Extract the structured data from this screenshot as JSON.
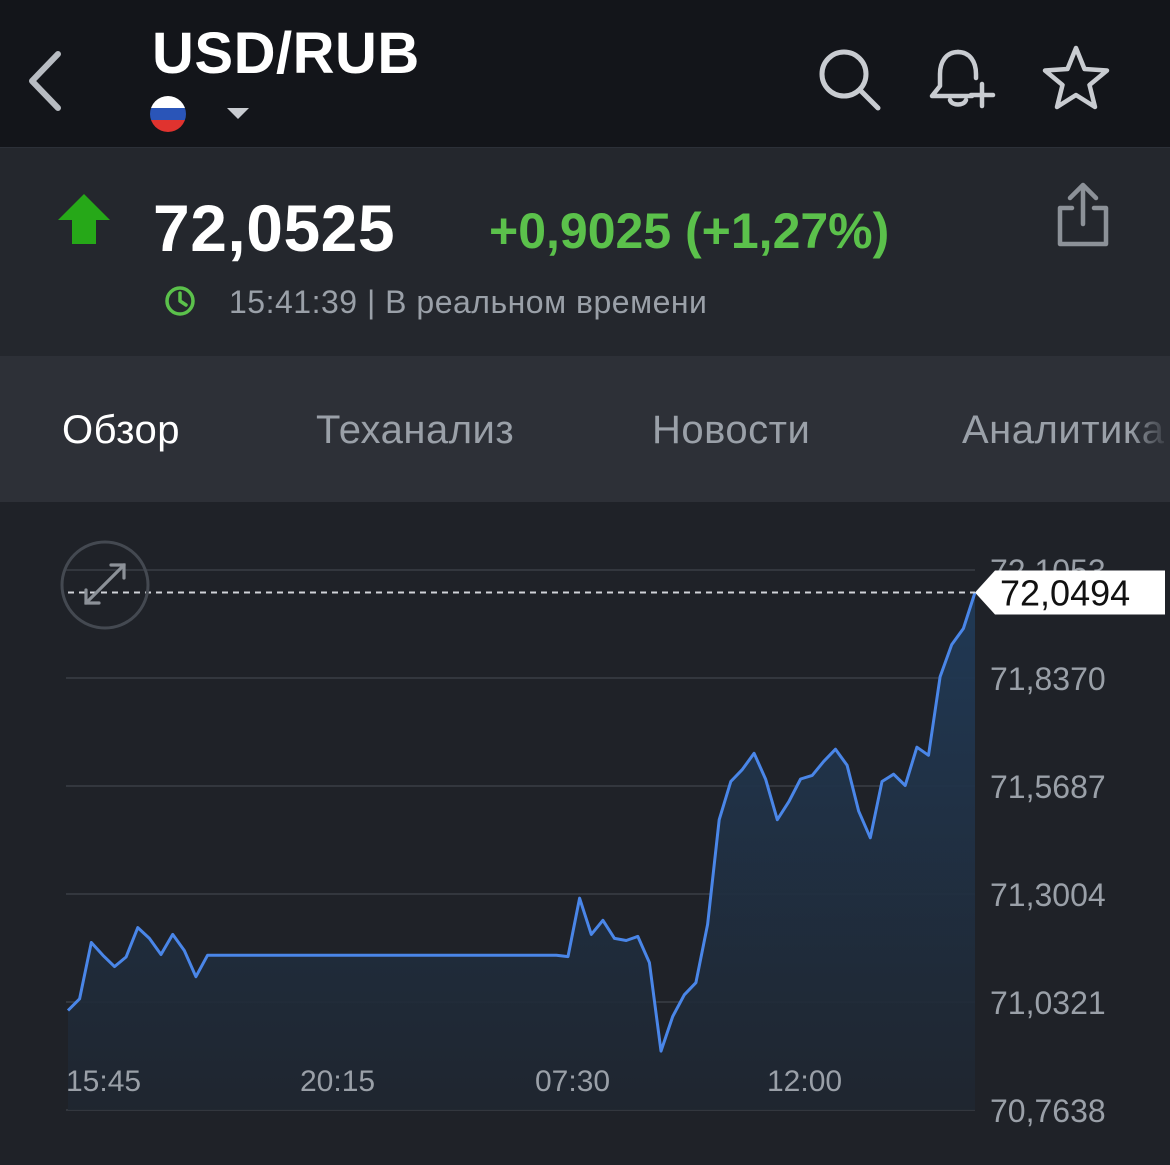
{
  "header": {
    "title": "USD/RUB",
    "icons": [
      "back-icon",
      "russia-flag-icon",
      "chevron-down-icon",
      "search-icon",
      "bell-plus-icon",
      "star-icon"
    ]
  },
  "quote": {
    "price": "72,0525",
    "change": "+0,9025 (+1,27%)",
    "time_text": "15:41:39 | В реальном времени",
    "direction": "up",
    "up_color": "#5bc14b"
  },
  "tabs": [
    {
      "label": "Обзор",
      "active": true
    },
    {
      "label": "Теханализ",
      "active": false
    },
    {
      "label": "Новости",
      "active": false
    },
    {
      "label": "Аналитика",
      "active": false
    }
  ],
  "chart_data": {
    "type": "area",
    "line_color": "#4a86e8",
    "x_tick_labels": [
      "15:45",
      "20:15",
      "07:30",
      "12:00"
    ],
    "y_tick_labels": [
      "72,1053",
      "71,8370",
      "71,5687",
      "71,3004",
      "71,0321",
      "70,7638"
    ],
    "ylim": [
      70.7638,
      72.1053
    ],
    "current_value": 72.0494,
    "current_label": "72,0494",
    "grid": true,
    "series": [
      {
        "values": [
          71.011,
          71.04,
          71.18,
          71.148,
          71.12,
          71.144,
          71.217,
          71.19,
          71.15,
          71.2,
          71.16,
          71.095,
          71.148,
          71.148,
          71.148,
          71.148,
          71.148,
          71.148,
          71.148,
          71.148,
          71.148,
          71.148,
          71.148,
          71.148,
          71.148,
          71.148,
          71.148,
          71.148,
          71.148,
          71.148,
          71.148,
          71.148,
          71.148,
          71.148,
          71.148,
          71.148,
          71.148,
          71.148,
          71.148,
          71.148,
          71.148,
          71.148,
          71.148,
          71.145,
          71.29,
          71.2,
          71.235,
          71.19,
          71.185,
          71.195,
          71.13,
          70.91,
          70.996,
          71.05,
          71.08,
          71.225,
          71.485,
          71.58,
          71.61,
          71.65,
          71.585,
          71.485,
          71.53,
          71.586,
          71.595,
          71.63,
          71.66,
          71.62,
          71.506,
          71.44,
          71.58,
          71.598,
          71.57,
          71.665,
          71.645,
          71.84,
          71.92,
          71.96,
          72.0494
        ]
      }
    ]
  }
}
